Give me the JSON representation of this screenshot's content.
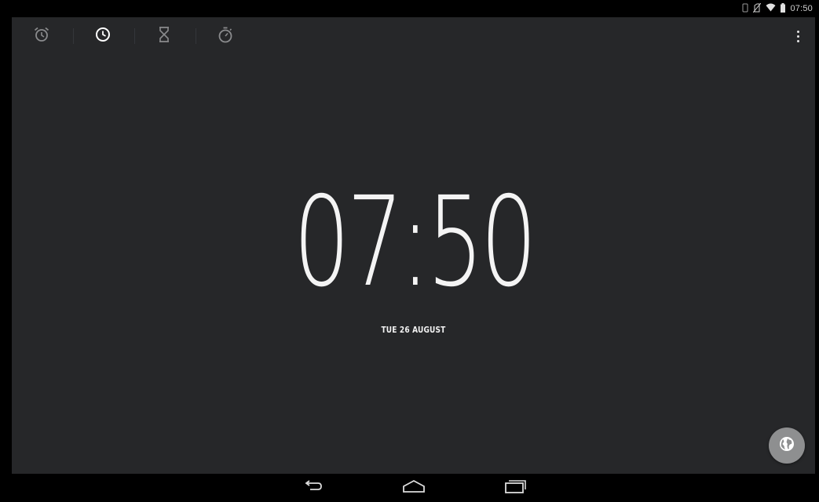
{
  "status_bar": {
    "time": "07:50",
    "icons": [
      "vibrate-icon",
      "no-sim-icon",
      "wifi-icon",
      "battery-icon"
    ]
  },
  "tabs": [
    {
      "icon": "alarm-icon",
      "selected": false
    },
    {
      "icon": "clock-icon",
      "selected": true
    },
    {
      "icon": "timer-icon",
      "selected": false
    },
    {
      "icon": "stopwatch-icon",
      "selected": false
    }
  ],
  "menu": {
    "icon": "overflow-menu-icon"
  },
  "clock": {
    "time": "07:50",
    "date": "TUE 26 AUGUST"
  },
  "fab": {
    "icon": "globe-icon"
  },
  "nav_bar": {
    "buttons": [
      "back-icon",
      "home-icon",
      "recents-icon"
    ]
  },
  "colors": {
    "background": "#262729",
    "text": "#f4f4f4",
    "inactive_icon": "#8a8b8d",
    "fab": "#8e8f90"
  }
}
